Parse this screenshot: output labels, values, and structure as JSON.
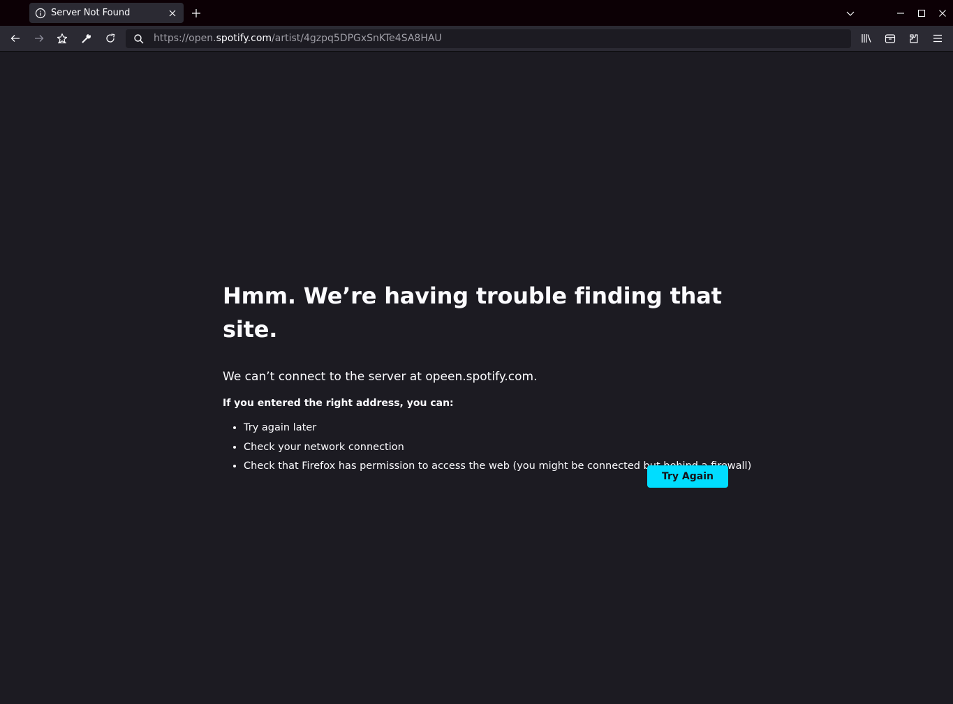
{
  "tab": {
    "title": "Server Not Found",
    "icon": "info-icon"
  },
  "address_bar": {
    "url_prefix": "https://open.",
    "url_domain": "spotify.com",
    "url_path": "/artist/4gzpq5DPGxSnKTe4SA8HAU"
  },
  "error": {
    "title": "Hmm. We’re having trouble finding that site.",
    "description": "We can’t connect to the server at opeen.spotify.com.",
    "subhead": "If you entered the right address, you can:",
    "suggestions": [
      "Try again later",
      "Check your network connection",
      "Check that Firefox has permission to access the web (you might be connected but behind a firewall)"
    ],
    "button_label": "Try Again"
  },
  "colors": {
    "accent": "#00ddff",
    "page_background": "#1c1b22",
    "toolbar_background": "#2b2a33"
  }
}
